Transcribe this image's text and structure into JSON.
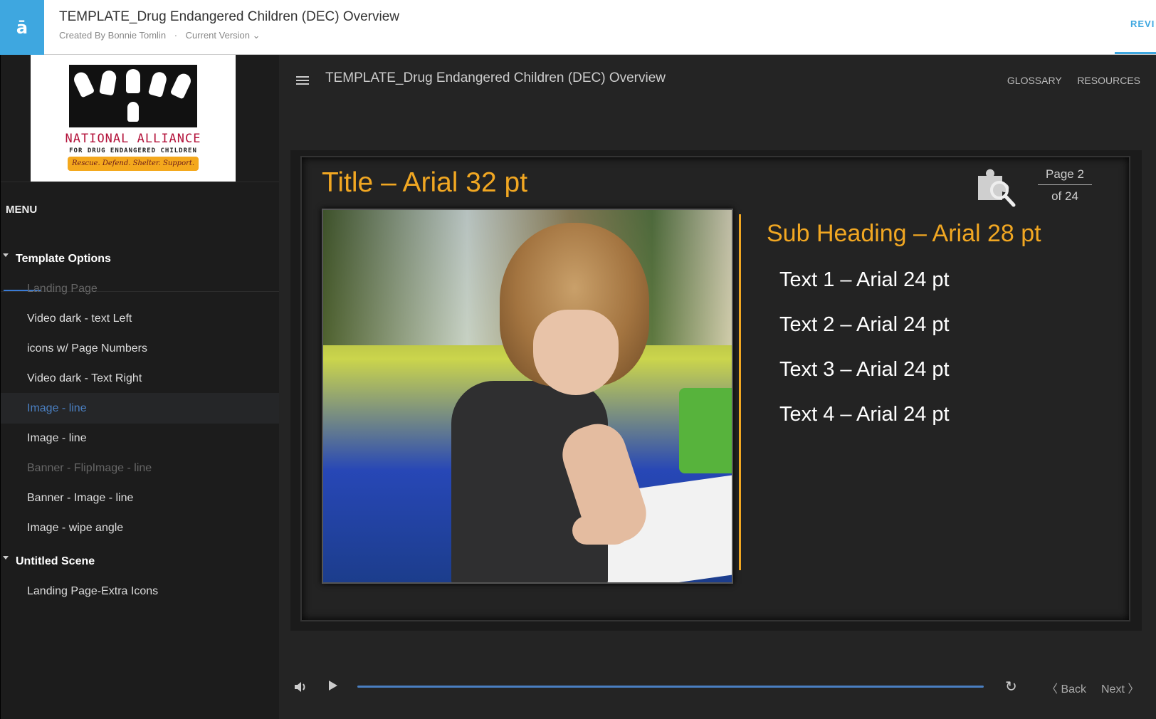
{
  "topbar": {
    "logo_glyph": "ā",
    "title": "TEMPLATE_Drug Endangered Children (DEC) Overview",
    "created_by": "Created By Bonnie Tomlin",
    "separator": "·",
    "version": "Current Version ⌄",
    "review_tab": "REVI"
  },
  "brand": {
    "name": "NATIONAL ALLIANCE",
    "sub": "FOR DRUG ENDANGERED CHILDREN",
    "tagline": "Rescue. Defend. Shelter. Support."
  },
  "sidebar": {
    "menu_label": "MENU",
    "items": [
      {
        "label": "Template Options",
        "type": "section"
      },
      {
        "label": "Landing Page",
        "type": "dim"
      },
      {
        "label": "Video dark - text Left",
        "type": "item"
      },
      {
        "label": "icons w/ Page Numbers",
        "type": "item"
      },
      {
        "label": "Video dark - Text Right",
        "type": "item"
      },
      {
        "label": "Image - line",
        "type": "active"
      },
      {
        "label": "Image - line",
        "type": "item"
      },
      {
        "label": "Banner - FlipImage - line",
        "type": "dim"
      },
      {
        "label": "Banner - Image - line",
        "type": "item"
      },
      {
        "label": "Image - wipe angle",
        "type": "item"
      },
      {
        "label": "Untitled Scene",
        "type": "section"
      },
      {
        "label": "Landing Page-Extra Icons",
        "type": "item"
      }
    ]
  },
  "player": {
    "title": "TEMPLATE_Drug Endangered Children (DEC) Overview",
    "glossary": "GLOSSARY",
    "resources": "RESOURCES"
  },
  "slide": {
    "title": "Title – Arial 32 pt",
    "page_line1": "Page 2",
    "page_line2": "of 24",
    "sub_heading": "Sub Heading – Arial 28 pt",
    "bullets": [
      "Text 1 – Arial 24 pt",
      "Text 2 – Arial 24 pt",
      "Text 3 – Arial 24 pt",
      "Text 4 – Arial 24 pt"
    ],
    "accent_color": "#f1a722"
  },
  "controls": {
    "replay_glyph": "↻",
    "back": "〈 Back",
    "next": "Next 〉"
  }
}
